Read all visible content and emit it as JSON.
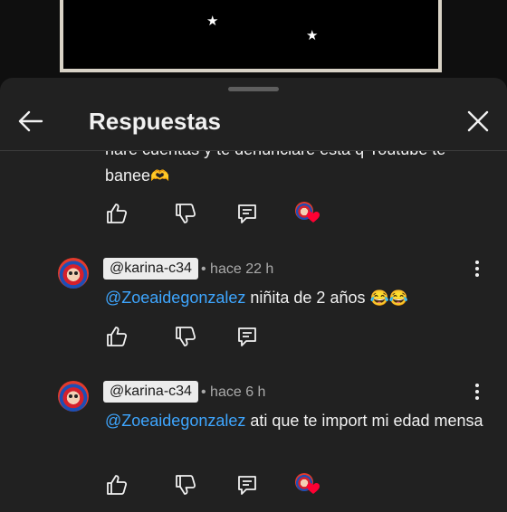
{
  "header": {
    "title": "Respuestas",
    "back_icon": "arrow-left-icon",
    "close_icon": "close-icon"
  },
  "partial_comment": {
    "line1": "haré cuentas y te denunciaré esta q Youtube te",
    "line2": "banee",
    "emoji": "🫶"
  },
  "replies": [
    {
      "author": "@karina-c34",
      "time": "• hace 22 h",
      "mention": "@Zoeaidegonzalez",
      "text": " niñita de 2 años ",
      "emoji": "😂😂",
      "creator_heart": false
    },
    {
      "author": "@karina-c34",
      "time": "• hace 6 h",
      "mention": "@Zoeaidegonzalez",
      "text": " ati que te import mi edad mensa",
      "emoji": "",
      "creator_heart": true
    }
  ],
  "colors": {
    "background": "#0f0f0f",
    "sheet": "#212121",
    "mention": "#3ea6ff",
    "secondary_text": "#aaaaaa",
    "heart": "#ff0033"
  }
}
